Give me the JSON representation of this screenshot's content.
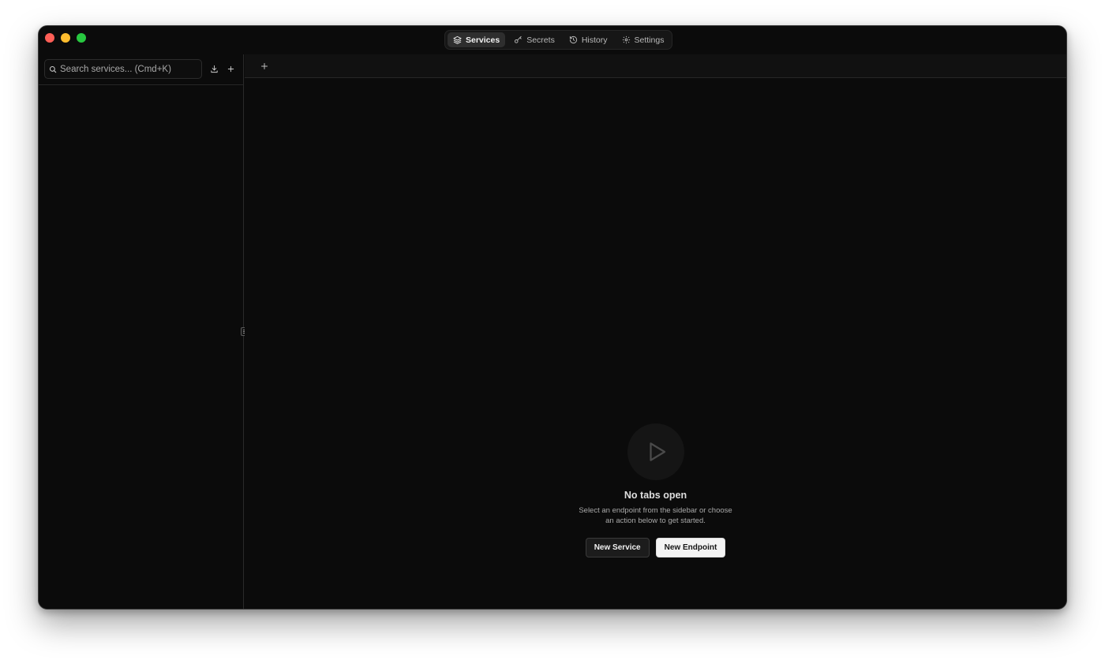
{
  "nav": {
    "tabs": [
      {
        "label": "Services",
        "icon": "layers-icon",
        "active": true
      },
      {
        "label": "Secrets",
        "icon": "key-icon",
        "active": false
      },
      {
        "label": "History",
        "icon": "history-icon",
        "active": false
      },
      {
        "label": "Settings",
        "icon": "gear-icon",
        "active": false
      }
    ]
  },
  "sidebar": {
    "search_placeholder": "Search services... (Cmd+K)",
    "import_icon": "download-icon",
    "add_icon": "plus-icon"
  },
  "tabbar": {
    "new_tab_icon": "plus-icon"
  },
  "empty_state": {
    "icon": "play-icon",
    "title": "No tabs open",
    "description": "Select an endpoint from the sidebar or choose an action below to get started.",
    "new_service_label": "New Service",
    "new_endpoint_label": "New Endpoint"
  },
  "colors": {
    "window_bg": "#0b0b0b",
    "accent_button": "#f3f3f3",
    "traffic_red": "#ff5f57",
    "traffic_yellow": "#febc2e",
    "traffic_green": "#28c840"
  }
}
